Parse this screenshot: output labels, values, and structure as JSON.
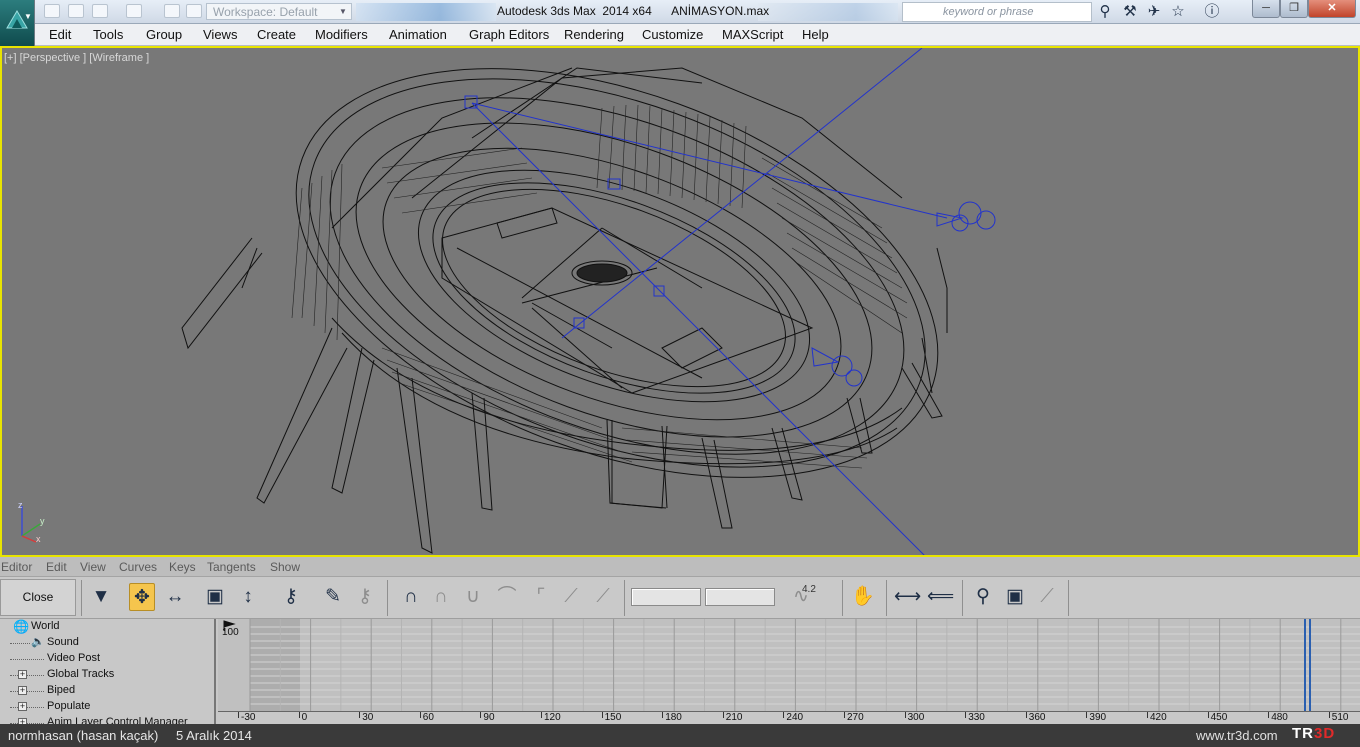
{
  "titlebar": {
    "workspace_label": "Workspace: Default",
    "title": "Autodesk 3ds Max  2014 x64      ANİMASYON.max",
    "search_placeholder": "keyword or phrase",
    "icons": [
      "binoculars-icon",
      "key-tools-icon",
      "satellite-icon",
      "star-icon",
      "help-icon"
    ]
  },
  "menubar": {
    "items": [
      "Edit",
      "Tools",
      "Group",
      "Views",
      "Create",
      "Modifiers",
      "Animation",
      "Graph Editors",
      "Rendering",
      "Customize",
      "MAXScript",
      "Help"
    ]
  },
  "viewport": {
    "label": "[+] [Perspective ] [Wireframe ]",
    "active_border_color": "#e8e400",
    "background_color": "#787878",
    "axis_labels": [
      "z",
      "y",
      "x"
    ]
  },
  "trackview": {
    "menu": [
      "Editor",
      "Edit",
      "View",
      "Curves",
      "Keys",
      "Tangents",
      "Show"
    ],
    "close_label": "Close",
    "tool_value": "4.2",
    "tree": [
      "World",
      "Sound",
      "Video Post",
      "Global Tracks",
      "Biped",
      "Populate",
      "Anim Layer Control Manager"
    ],
    "value_label": "100",
    "ruler_ticks": [
      "-30",
      "0",
      "30",
      "60",
      "90",
      "120",
      "150",
      "180",
      "210",
      "240",
      "270",
      "300",
      "330",
      "360",
      "390",
      "420",
      "450",
      "480",
      "510"
    ]
  },
  "statusbar": {
    "user": "normhasan (hasan kaçak)",
    "date": "5 Aralık 2014",
    "site": "www.tr3d.com",
    "logo_left": "TR",
    "logo_right": "3D"
  }
}
